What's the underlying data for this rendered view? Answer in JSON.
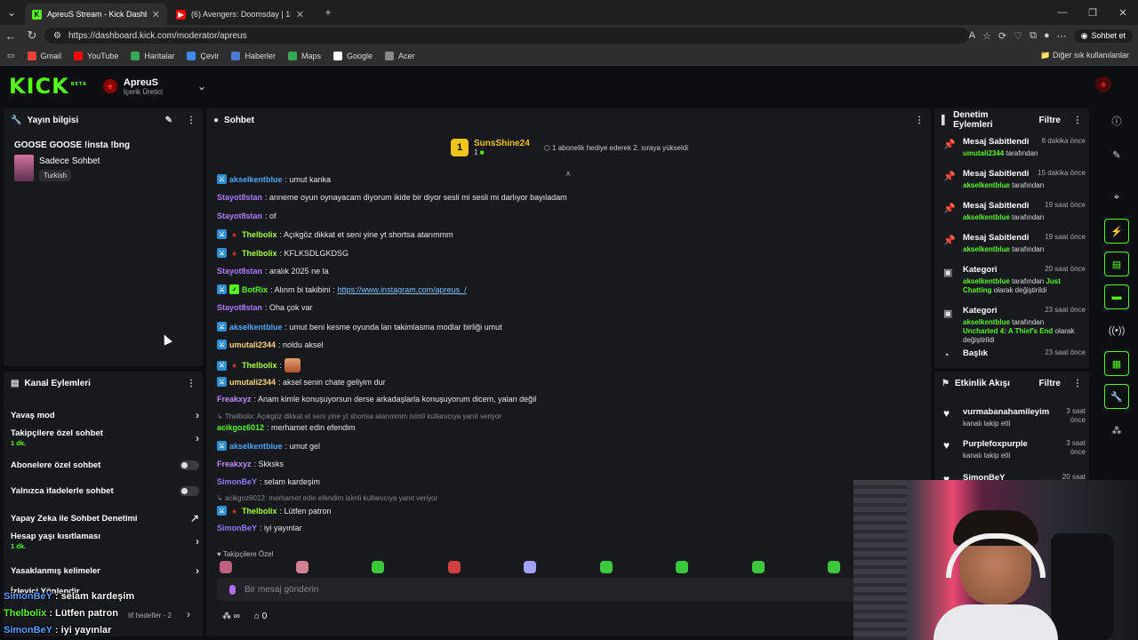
{
  "browser": {
    "tabs": [
      {
        "title": "ApreuS Stream - Kick Dashboard",
        "active": true
      },
      {
        "title": "(6) Avengers: Doomsday | 18 Aralık",
        "active": false
      }
    ],
    "url": "https://dashboard.kick.com/moderator/apreus",
    "copilot_label": "Sohbet et",
    "bookmarks": [
      {
        "label": "Gmail",
        "color": "#ea4335"
      },
      {
        "label": "YouTube",
        "color": "#ff0000"
      },
      {
        "label": "Haritalar",
        "color": "#34a853"
      },
      {
        "label": "Çevir",
        "color": "#4285f4"
      },
      {
        "label": "Haberler",
        "color": "#4a7bd0"
      },
      {
        "label": "Maps",
        "color": "#34a853"
      },
      {
        "label": "Google",
        "color": "#ffffff"
      },
      {
        "label": "Acer",
        "color": "#888888"
      }
    ],
    "bookmarks_more": "Diğer sık kullanılanlar"
  },
  "kick": {
    "logo": "KICK",
    "beta": "BETA",
    "channel_name": "ApreuS",
    "channel_role": "İçerik Üretici"
  },
  "stream_info": {
    "header": "Yayın bilgisi",
    "title": "GOOSE GOOSE !insta !bng",
    "category": "Sadece Sohbet",
    "language": "Turkish"
  },
  "channel_actions": {
    "header": "Kanal Eylemleri",
    "rows": [
      {
        "label": "Yavaş mod",
        "sub": "",
        "control": "chevron"
      },
      {
        "label": "Takipçilere özel sohbet",
        "sub": "1 dk.",
        "control": "chevron"
      },
      {
        "label": "Abonelere özel sohbet",
        "sub": "",
        "control": "toggle"
      },
      {
        "label": "Yalnızca ifadelerle sohbet",
        "sub": "",
        "control": "toggle"
      },
      {
        "label": "Yapay Zeka ile Sohbet Denetimi",
        "sub": "",
        "control": "external"
      },
      {
        "label": "Hesap yaşı kısıtlaması",
        "sub": "1 dk.",
        "control": "chevron"
      },
      {
        "label": "Yasaklanmış kelimeler",
        "sub": "",
        "control": "chevron"
      },
      {
        "label": "İzleyici Yönlendir",
        "sub": "",
        "control": "none"
      }
    ],
    "last_row_partial": "tif hedefler - 2"
  },
  "chat": {
    "header": "Sohbet",
    "banner": {
      "badge": "1",
      "name": "SunsShine24",
      "count": "1",
      "text": "1 abonelik hediye ederek 2. sıraya yükseldi"
    },
    "messages": [
      {
        "badges": [
          "blue"
        ],
        "user": "akselkentblue",
        "color": "#4aa8ff",
        "text": ": umut kanka"
      },
      {
        "badges": [],
        "user": "Stayot8stan",
        "color": "#b07aff",
        "text": ": anneme oyun oynayacam diyorum ikide bir diyor sesli mi sesli mi darlıyor bayıladam"
      },
      {
        "badges": [],
        "user": "Stayot8stan",
        "color": "#b07aff",
        "text": ": of"
      },
      {
        "badges": [
          "blue",
          "red"
        ],
        "user": "Thelbolix",
        "color": "#a3ff3c",
        "text": ": Açıkgöz dikkat et seni yine yt shortsa atarımmm"
      },
      {
        "badges": [
          "blue",
          "red"
        ],
        "user": "Thelbolix",
        "color": "#a3ff3c",
        "text": ": KFLKSDLGKDSG"
      },
      {
        "badges": [],
        "user": "Stayot8stan",
        "color": "#b07aff",
        "text": ": aralık 2025 ne la"
      },
      {
        "badges": [
          "blue",
          "green"
        ],
        "user": "BotRix",
        "color": "#53fc18",
        "text": ": Alınm bi takibini : ",
        "link": "https://www.instagram.com/apreus_/"
      },
      {
        "badges": [],
        "user": "Stayot8stan",
        "color": "#b07aff",
        "text": ": Oha çok var"
      },
      {
        "badges": [
          "blue"
        ],
        "user": "akselkentblue",
        "color": "#4aa8ff",
        "text": ": umut beni kesme oyunda lan takimlasma modlar birliği umut"
      },
      {
        "badges": [
          "blue"
        ],
        "user": "umutali2344",
        "color": "#ffd27a",
        "text": ": noldu aksel"
      },
      {
        "badges": [
          "blue",
          "red"
        ],
        "user": "Thelbolix",
        "color": "#a3ff3c",
        "text": ": ",
        "emote": true
      },
      {
        "badges": [
          "blue"
        ],
        "user": "umutali2344",
        "color": "#ffd27a",
        "text": ": aksel senin chate geliyim dur"
      },
      {
        "badges": [],
        "user": "Freakxyz",
        "color": "#c08cff",
        "text": ": Anam kimle konuşuyorsun derse arkadaşlarla konuşuyorum dicem, yalan değil"
      },
      {
        "reply": "Thelbolix: Açıkgöz dikkat et seni yine yt shortsa atarımmm isimli kullanıcıya yanıt veriyor"
      },
      {
        "badges": [],
        "user": "acikgoz6012",
        "color": "#53fc18",
        "text": ": merhamet edin efendim"
      },
      {
        "badges": [
          "blue"
        ],
        "user": "akselkentblue",
        "color": "#4aa8ff",
        "text": ": umut gel"
      },
      {
        "badges": [],
        "user": "Freakxyz",
        "color": "#c08cff",
        "text": ": Skksks"
      },
      {
        "badges": [],
        "user": "SimonBeY",
        "color": "#8c7aff",
        "text": ": selam kardeşim"
      },
      {
        "reply": "acikgoz6012: merhamet edin efendim isimli kullanıcıya yanıt veriyor"
      },
      {
        "badges": [
          "blue",
          "red"
        ],
        "user": "Thelbolix",
        "color": "#a3ff3c",
        "text": ": Lütfen patron"
      },
      {
        "badges": [],
        "user": "SimonBeY",
        "color": "#8c7aff",
        "text": ": iyi yayınlar"
      }
    ],
    "emote_section_label": "Takipçilere Özel",
    "emote_colors": [
      "#c06080",
      "#d08090",
      "#3cc83c",
      "#d04040",
      "#a0a0ff",
      "#3cc83c",
      "#3cc83c",
      "#3cc83c",
      "#3cc83c"
    ],
    "input_placeholder": "Bir mesaj gönderin",
    "footer_points_icon": "∞",
    "footer_count": "0"
  },
  "mod_actions": {
    "header": "Denetim Eylemleri",
    "filter": "Filtre",
    "items": [
      {
        "icon": "pin-icon",
        "title": "Mesaj Sabitlendi",
        "time": "8 dakika önce",
        "by": "umutali2344",
        "by_suffix": " tarafından"
      },
      {
        "icon": "pin-icon",
        "title": "Mesaj Sabitlendi",
        "time": "15 dakika önce",
        "by": "akselkentblue",
        "by_suffix": " tarafından"
      },
      {
        "icon": "pin-icon",
        "title": "Mesaj Sabitlendi",
        "time": "19 saat önce",
        "by": "akselkentblue",
        "by_suffix": " tarafından"
      },
      {
        "icon": "pin-icon",
        "title": "Mesaj Sabitlendi",
        "time": "19 saat önce",
        "by": "akselkentblue",
        "by_suffix": " tarafından"
      },
      {
        "icon": "category-icon",
        "title": "Kategori",
        "time": "20 saat önce",
        "by": "akselkentblue",
        "by_suffix": " tarafından ",
        "target": "Just Chatting",
        "tail": " olarak değiştirildi"
      },
      {
        "icon": "category-icon",
        "title": "Kategori",
        "time": "23 saat önce",
        "by": "akselkentblue",
        "by_suffix": " tarafından ",
        "target": "Uncharted 4: A Thief's End",
        "tail": " olarak değiştirildi"
      },
      {
        "icon": "title-icon",
        "title": "Başlık",
        "time": "23 saat önce",
        "by": "",
        "by_suffix": ""
      }
    ]
  },
  "activity": {
    "header": "Etkinlik Akışı",
    "filter": "Filtre",
    "items": [
      {
        "name": "vurmabanahamileyim",
        "sub": "kanalı takip etti",
        "time": "3 saat önce"
      },
      {
        "name": "Purplefoxpurple",
        "sub": "kanalı takip etti",
        "time": "3 saat önce"
      },
      {
        "name": "SimonBeY",
        "sub": "",
        "time": "20 saat önce"
      }
    ]
  },
  "overlay": [
    {
      "user": "SimonBeY",
      "text": " : selam kardeşim"
    },
    {
      "user": "Thelbolix",
      "text": " : Lütfen patron"
    },
    {
      "user": "SimonBeY",
      "text": " : iyi yayınlar"
    }
  ]
}
